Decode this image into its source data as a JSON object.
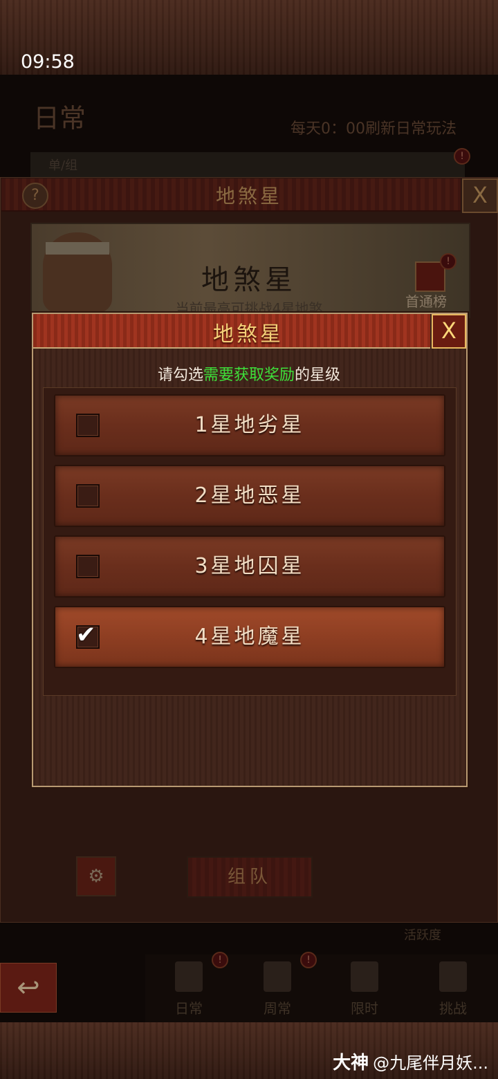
{
  "status_bar": {
    "time": "09:58"
  },
  "background_page": {
    "title": "日常",
    "refresh_text": "每天0：00刷新日常玩法",
    "tab_label": "单/组",
    "activity_label": "活跃度",
    "nav": [
      {
        "label": "日常",
        "icon": "book-icon"
      },
      {
        "label": "周常",
        "icon": "scroll-icon"
      },
      {
        "label": "限时",
        "icon": "hourglass-icon"
      },
      {
        "label": "挑战",
        "icon": "crossed-swords-icon"
      }
    ],
    "back_icon": "back-arrow-icon"
  },
  "outer_panel": {
    "help_glyph": "?",
    "title": "地煞星",
    "close_glyph": "X",
    "banner": {
      "title": "地煞星",
      "subtitle": "当前最高可挑战4星地煞",
      "rank_label": "首通榜",
      "alert_glyph": "!"
    },
    "team_button": "组队",
    "settings_icon": "gear-icon"
  },
  "dialog": {
    "title": "地煞星",
    "close_glyph": "X",
    "instruction_prefix": "请勾选",
    "instruction_highlight": "需要获取奖励",
    "instruction_suffix": "的星级",
    "check_glyph": "✔",
    "options": [
      {
        "label": "1星地劣星",
        "checked": false
      },
      {
        "label": "2星地恶星",
        "checked": false
      },
      {
        "label": "3星地囚星",
        "checked": false
      },
      {
        "label": "4星地魔星",
        "checked": true
      }
    ]
  },
  "watermark": {
    "brand": "大神",
    "text": "@九尾伴月妖..."
  },
  "colors": {
    "dialog_title": "#f4d078",
    "instruction_highlight": "#3ee03a",
    "dialog_border": "#b89a72"
  }
}
